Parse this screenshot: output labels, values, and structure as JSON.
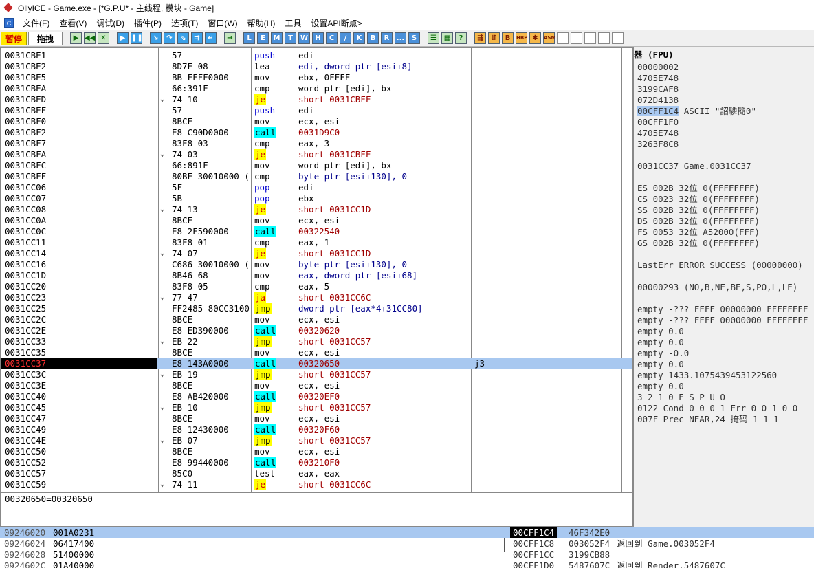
{
  "window": {
    "title": "OllyICE - Game.exe - [*G.P.U* - 主线程, 模块 - Game]"
  },
  "menu": [
    "文件(F)",
    "查看(V)",
    "调试(D)",
    "插件(P)",
    "选项(T)",
    "窗口(W)",
    "帮助(H)",
    "工具",
    "设置API断点>"
  ],
  "toolbar": {
    "state": "暂停",
    "drag": "拖拽",
    "buttons_a": [
      "open-icon",
      "rewind-icon",
      "close-icon"
    ],
    "buttons_b": [
      "run-icon",
      "pause-icon"
    ],
    "buttons_c": [
      "step-into-icon",
      "step-over-icon",
      "trace-into-icon",
      "trace-over-icon",
      "execute-till-return-icon"
    ],
    "buttons_d": [
      "goto-icon"
    ],
    "letters": [
      "L",
      "E",
      "M",
      "T",
      "W",
      "H",
      "C",
      "/",
      "K",
      "B",
      "R",
      "...",
      "S"
    ],
    "buttons_e": [
      "list-icon",
      "grid-icon",
      "help-icon"
    ],
    "buttons_f": [
      "hook-icon",
      "hook2-icon",
      "breakpoint-icon",
      "HBP",
      "gear-icon",
      "ASM"
    ],
    "blank_count": 5
  },
  "cpu": {
    "rows": [
      {
        "addr": "0031CBE1",
        "jump": "",
        "hex": "57",
        "mn": "push",
        "mnc": "push",
        "op": "edi",
        "opc": "norm",
        "cmt": ""
      },
      {
        "addr": "0031CBE2",
        "jump": "",
        "hex": "8D7E 08",
        "mn": "lea",
        "mnc": "norm",
        "op": "edi, dword ptr [esi+8]",
        "opc": "blue",
        "cmt": ""
      },
      {
        "addr": "0031CBE5",
        "jump": "",
        "hex": "BB FFFF0000",
        "mn": "mov",
        "mnc": "norm",
        "op": "ebx, 0FFFF",
        "opc": "norm",
        "cmt": ""
      },
      {
        "addr": "0031CBEA",
        "jump": "",
        "hex": "66:391F",
        "mn": "cmp",
        "mnc": "norm",
        "op": "word ptr [edi], bx",
        "opc": "norm",
        "cmt": ""
      },
      {
        "addr": "0031CBED",
        "jump": "⌄",
        "hex": "74 10",
        "mn": "je",
        "mnc": "jcc",
        "op": "short 0031CBFF",
        "opc": "red",
        "cmt": ""
      },
      {
        "addr": "0031CBEF",
        "jump": "",
        "hex": "57",
        "mn": "push",
        "mnc": "push",
        "op": "edi",
        "opc": "norm",
        "cmt": ""
      },
      {
        "addr": "0031CBF0",
        "jump": "",
        "hex": "8BCE",
        "mn": "mov",
        "mnc": "norm",
        "op": "ecx, esi",
        "opc": "norm",
        "cmt": ""
      },
      {
        "addr": "0031CBF2",
        "jump": "",
        "hex": "E8 C90D0000",
        "mn": "call",
        "mnc": "call",
        "op": "0031D9C0",
        "opc": "red",
        "cmt": ""
      },
      {
        "addr": "0031CBF7",
        "jump": "",
        "hex": "83F8 03",
        "mn": "cmp",
        "mnc": "norm",
        "op": "eax, 3",
        "opc": "norm",
        "cmt": ""
      },
      {
        "addr": "0031CBFA",
        "jump": "⌄",
        "hex": "74 03",
        "mn": "je",
        "mnc": "jcc",
        "op": "short 0031CBFF",
        "opc": "red",
        "cmt": ""
      },
      {
        "addr": "0031CBFC",
        "jump": "",
        "hex": "66:891F",
        "mn": "mov",
        "mnc": "norm",
        "op": "word ptr [edi], bx",
        "opc": "norm",
        "cmt": ""
      },
      {
        "addr": "0031CBFF",
        "jump": "",
        "hex": "80BE 30010000 (",
        "mn": "cmp",
        "mnc": "norm",
        "op": "byte ptr [esi+130], 0",
        "opc": "blue",
        "cmt": ""
      },
      {
        "addr": "0031CC06",
        "jump": "",
        "hex": "5F",
        "mn": "pop",
        "mnc": "push",
        "op": "edi",
        "opc": "norm",
        "cmt": ""
      },
      {
        "addr": "0031CC07",
        "jump": "",
        "hex": "5B",
        "mn": "pop",
        "mnc": "push",
        "op": "ebx",
        "opc": "norm",
        "cmt": ""
      },
      {
        "addr": "0031CC08",
        "jump": "⌄",
        "hex": "74 13",
        "mn": "je",
        "mnc": "jcc",
        "op": "short 0031CC1D",
        "opc": "red",
        "cmt": ""
      },
      {
        "addr": "0031CC0A",
        "jump": "",
        "hex": "8BCE",
        "mn": "mov",
        "mnc": "norm",
        "op": "ecx, esi",
        "opc": "norm",
        "cmt": ""
      },
      {
        "addr": "0031CC0C",
        "jump": "",
        "hex": "E8 2F590000",
        "mn": "call",
        "mnc": "call",
        "op": "00322540",
        "opc": "red",
        "cmt": ""
      },
      {
        "addr": "0031CC11",
        "jump": "",
        "hex": "83F8 01",
        "mn": "cmp",
        "mnc": "norm",
        "op": "eax, 1",
        "opc": "norm",
        "cmt": ""
      },
      {
        "addr": "0031CC14",
        "jump": "⌄",
        "hex": "74 07",
        "mn": "je",
        "mnc": "jcc",
        "op": "short 0031CC1D",
        "opc": "red",
        "cmt": ""
      },
      {
        "addr": "0031CC16",
        "jump": "",
        "hex": "C686 30010000 (",
        "mn": "mov",
        "mnc": "norm",
        "op": "byte ptr [esi+130], 0",
        "opc": "blue",
        "cmt": ""
      },
      {
        "addr": "0031CC1D",
        "jump": "",
        "hex": "8B46 68",
        "mn": "mov",
        "mnc": "norm",
        "op": "eax, dword ptr [esi+68]",
        "opc": "blue",
        "cmt": ""
      },
      {
        "addr": "0031CC20",
        "jump": "",
        "hex": "83F8 05",
        "mn": "cmp",
        "mnc": "norm",
        "op": "eax, 5",
        "opc": "norm",
        "cmt": ""
      },
      {
        "addr": "0031CC23",
        "jump": "⌄",
        "hex": "77 47",
        "mn": "ja",
        "mnc": "jcc",
        "op": "short 0031CC6C",
        "opc": "red",
        "cmt": ""
      },
      {
        "addr": "0031CC25",
        "jump": "",
        "hex": "FF2485 80CC3100",
        "mn": "jmp",
        "mnc": "jmp",
        "op": "dword ptr [eax*4+31CC80]",
        "opc": "blue",
        "cmt": ""
      },
      {
        "addr": "0031CC2C",
        "jump": "",
        "hex": "8BCE",
        "mn": "mov",
        "mnc": "norm",
        "op": "ecx, esi",
        "opc": "norm",
        "cmt": ""
      },
      {
        "addr": "0031CC2E",
        "jump": "",
        "hex": "E8 ED390000",
        "mn": "call",
        "mnc": "call",
        "op": "00320620",
        "opc": "red",
        "cmt": ""
      },
      {
        "addr": "0031CC33",
        "jump": "⌄",
        "hex": "EB 22",
        "mn": "jmp",
        "mnc": "jmp",
        "op": "short 0031CC57",
        "opc": "red",
        "cmt": ""
      },
      {
        "addr": "0031CC35",
        "jump": "",
        "hex": "8BCE",
        "mn": "mov",
        "mnc": "norm",
        "op": "ecx, esi",
        "opc": "norm",
        "cmt": ""
      },
      {
        "addr": "0031CC37",
        "jump": "",
        "hex": "E8 143A0000",
        "mn": "call",
        "mnc": "call",
        "op": "00320650",
        "opc": "red",
        "cmt": "j3",
        "current": true
      },
      {
        "addr": "0031CC3C",
        "jump": "⌄",
        "hex": "EB 19",
        "mn": "jmp",
        "mnc": "jmp",
        "op": "short 0031CC57",
        "opc": "red",
        "cmt": ""
      },
      {
        "addr": "0031CC3E",
        "jump": "",
        "hex": "8BCE",
        "mn": "mov",
        "mnc": "norm",
        "op": "ecx, esi",
        "opc": "norm",
        "cmt": ""
      },
      {
        "addr": "0031CC40",
        "jump": "",
        "hex": "E8 AB420000",
        "mn": "call",
        "mnc": "call",
        "op": "00320EF0",
        "opc": "red",
        "cmt": ""
      },
      {
        "addr": "0031CC45",
        "jump": "⌄",
        "hex": "EB 10",
        "mn": "jmp",
        "mnc": "jmp",
        "op": "short 0031CC57",
        "opc": "red",
        "cmt": ""
      },
      {
        "addr": "0031CC47",
        "jump": "",
        "hex": "8BCE",
        "mn": "mov",
        "mnc": "norm",
        "op": "ecx, esi",
        "opc": "norm",
        "cmt": ""
      },
      {
        "addr": "0031CC49",
        "jump": "",
        "hex": "E8 12430000",
        "mn": "call",
        "mnc": "call",
        "op": "00320F60",
        "opc": "red",
        "cmt": ""
      },
      {
        "addr": "0031CC4E",
        "jump": "⌄",
        "hex": "EB 07",
        "mn": "jmp",
        "mnc": "jmp",
        "op": "short 0031CC57",
        "opc": "red",
        "cmt": ""
      },
      {
        "addr": "0031CC50",
        "jump": "",
        "hex": "8BCE",
        "mn": "mov",
        "mnc": "norm",
        "op": "ecx, esi",
        "opc": "norm",
        "cmt": ""
      },
      {
        "addr": "0031CC52",
        "jump": "",
        "hex": "E8 99440000",
        "mn": "call",
        "mnc": "call",
        "op": "003210F0",
        "opc": "red",
        "cmt": ""
      },
      {
        "addr": "0031CC57",
        "jump": "",
        "hex": "85C0",
        "mn": "test",
        "mnc": "norm",
        "op": "eax, eax",
        "opc": "norm",
        "cmt": ""
      },
      {
        "addr": "0031CC59",
        "jump": "⌄",
        "hex": "74 11",
        "mn": "je",
        "mnc": "jcc",
        "op": "short 0031CC6C",
        "opc": "red",
        "cmt": ""
      }
    ]
  },
  "info": {
    "text": "00320650=00320650"
  },
  "registers": {
    "header": "器 (FPU)",
    "lines": [
      "00000002",
      "4705E748",
      "3199CAF8",
      "072D4138",
      "00CFF1C4 ASCII \"詔驎鬜0\"",
      "00CFF1F0",
      "4705E748",
      "3263F8C8",
      "",
      "0031CC37 Game.0031CC37",
      "",
      " ES 002B 32位 0(FFFFFFFF)",
      " CS 0023 32位 0(FFFFFFFF)",
      " SS 002B 32位 0(FFFFFFFF)",
      " DS 002B 32位 0(FFFFFFFF)",
      " FS 0053 32位 A52000(FFF)",
      " GS 002B 32位 0(FFFFFFFF)",
      "",
      " LastErr ERROR_SUCCESS (00000000)",
      "",
      "00000293 (NO,B,NE,BE,S,PO,L,LE)",
      "",
      "empty -??? FFFF 00000000 FFFFFFFF",
      "empty -??? FFFF 00000000 FFFFFFFF",
      "empty 0.0",
      "empty 0.0",
      "empty -0.0",
      "empty 0.0",
      "empty 1433.1075439453122560",
      "empty 0.0",
      "       3 2 1 0      E S P U O",
      "0122  Cond 0 0 0 1  Err 0 0 1 0 0",
      "007F  Prec NEAR,24  掩码    1 1 1"
    ]
  },
  "dump": {
    "rows": [
      {
        "addr": "09246020",
        "hex": "001A0231"
      },
      {
        "addr": "09246024",
        "hex": "06417400"
      },
      {
        "addr": "09246028",
        "hex": "51400000"
      },
      {
        "addr": "0924602C",
        "hex": "01A40000"
      }
    ]
  },
  "stack": {
    "rows": [
      {
        "addr": "00CFF1C4",
        "val": "46F342E0",
        "cmt": ""
      },
      {
        "addr": "00CFF1C8",
        "val": "003052F4",
        "cmt": "返回到 Game.003052F4"
      },
      {
        "addr": "00CFF1CC",
        "val": "3199CB88",
        "cmt": ""
      },
      {
        "addr": "00CFF1D0",
        "val": "5487607C",
        "cmt": "返回到 Render.5487607C"
      }
    ]
  },
  "colors": {
    "highlight": "#a8c8f0",
    "call_bg": "#00ffff",
    "jmp_bg": "#ffff00",
    "current_addr_bg": "#000000",
    "current_addr_fg": "#ff3030"
  }
}
